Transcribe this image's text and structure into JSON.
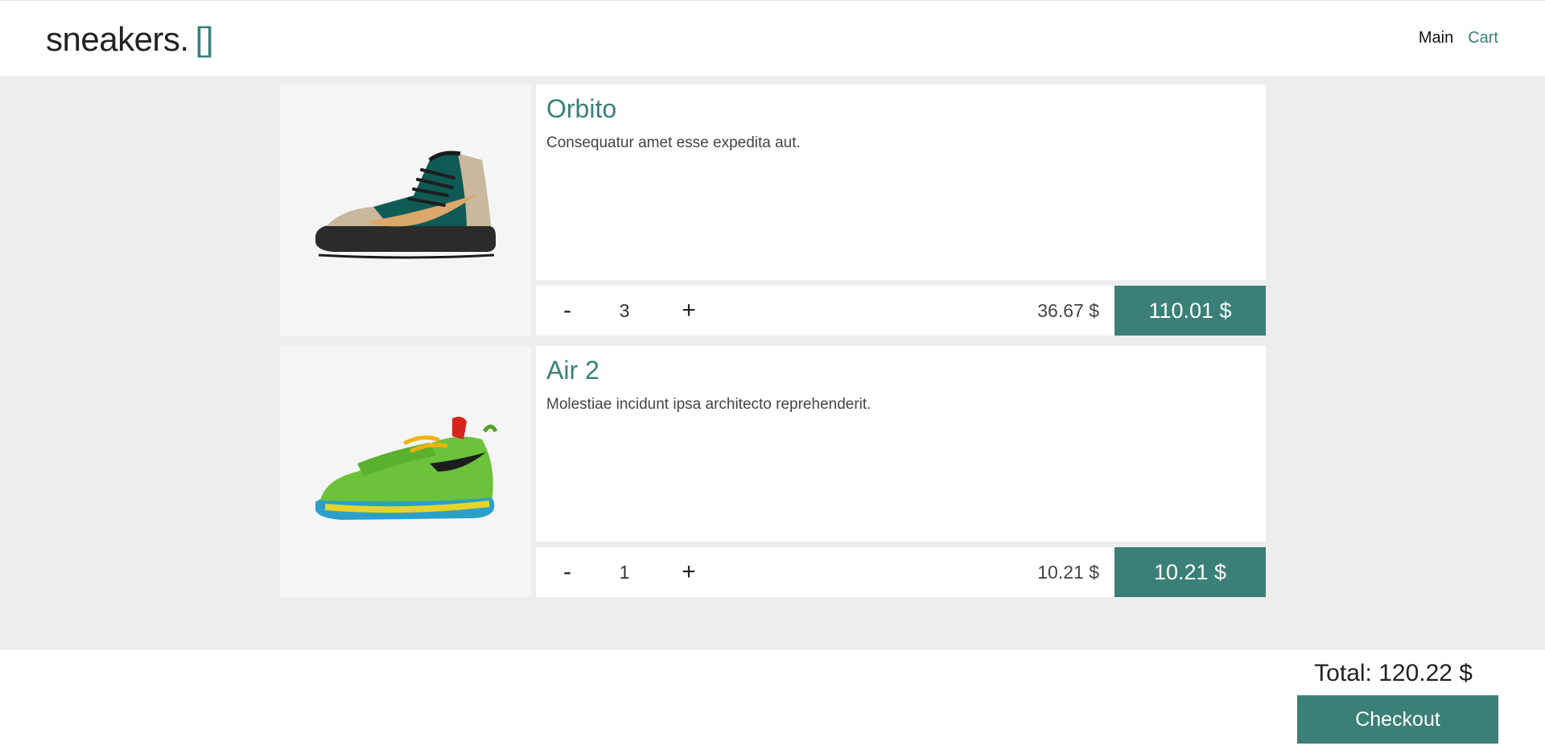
{
  "header": {
    "logo_text": "sneakers.",
    "logo_brackets": "[]",
    "nav": {
      "main_label": "Main",
      "cart_label": "Cart"
    }
  },
  "cart": {
    "items": [
      {
        "name": "Orbito",
        "description": "Consequatur amet esse expedita aut.",
        "quantity": "3",
        "unit_price": "36.67 $",
        "line_total": "110.01 $",
        "minus_label": "-",
        "plus_label": "+",
        "image_icon": "high-top-sneaker-teal"
      },
      {
        "name": "Air 2",
        "description": "Molestiae incidunt ipsa architecto reprehenderit.",
        "quantity": "1",
        "unit_price": "10.21 $",
        "line_total": "10.21 $",
        "minus_label": "-",
        "plus_label": "+",
        "image_icon": "low-top-sneaker-green"
      }
    ]
  },
  "footer": {
    "total_text": "Total: 120.22 $",
    "checkout_label": "Checkout"
  },
  "colors": {
    "accent": "#3a8078",
    "background": "#ededed",
    "card": "#ffffff",
    "image_bg": "#f5f5f5"
  }
}
